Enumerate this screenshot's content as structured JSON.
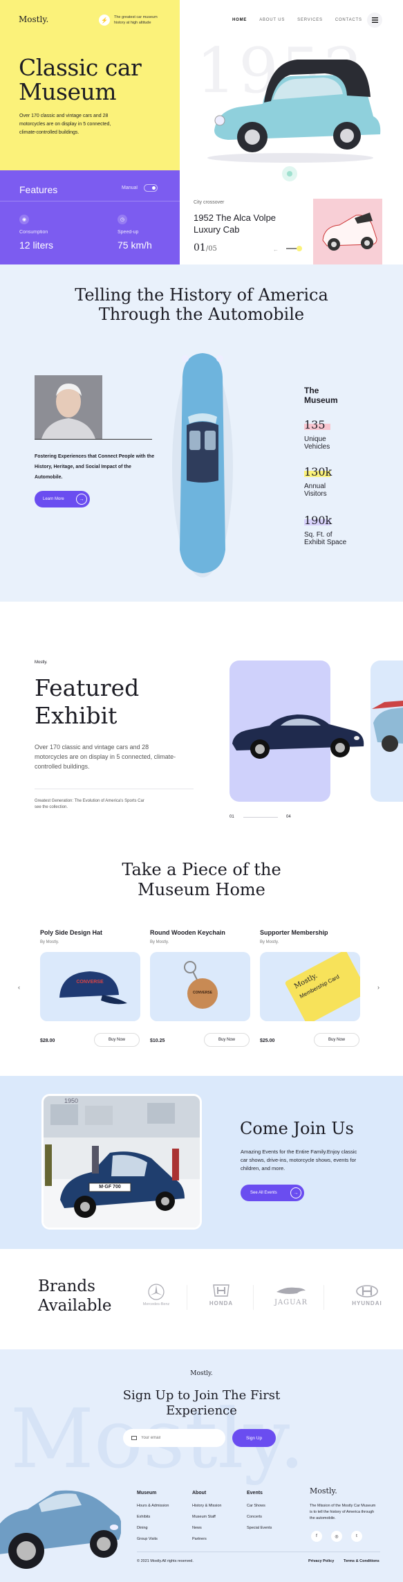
{
  "brand": {
    "logo": "Mostly.",
    "tagline": "The greatest car museum history at high altitude"
  },
  "nav": {
    "items": [
      "HOME",
      "ABOUT US",
      "SERVICES",
      "CONTACTS"
    ],
    "active": "HOME",
    "menu_icon": "hamburger-icon"
  },
  "hero": {
    "title_line1": "Classic car",
    "title_line2": "Museum",
    "description": "Over 170 classic and vintage cars and 28 motorcycles are on display in 5 connected, climate-controlled buildings.",
    "bg_year": "1952",
    "features_label": "Features",
    "manual_label": "Manual",
    "consumption_label": "Consumption",
    "consumption_value": "12 liters",
    "speed_label": "Speed-up",
    "speed_value": "75 km/h",
    "car_category": "City crossover",
    "car_name_line1": "1952 The Alca Volpe",
    "car_name_line2": "Luxury Cab",
    "slide_current": "01",
    "slide_total": "/05",
    "colors": {
      "yellow": "#fbf27a",
      "purple": "#7c5cf0",
      "pink": "#f8cfd6"
    }
  },
  "history": {
    "title_line1": "Telling the History of America",
    "title_line2": "Through the Automobile",
    "description": "Fostering Experiences that Connect People with the History, Heritage, and Social Impact of the Automobile.",
    "cta": "Learn More",
    "museum_label_line1": "The",
    "museum_label_line2": "Museum",
    "stats": [
      {
        "value": "135",
        "label_line1": "Unique",
        "label_line2": "Vehicles",
        "color": "#f8c6d0"
      },
      {
        "value": "130k",
        "label_line1": "Annual",
        "label_line2": "Visitors",
        "color": "#fbf27a"
      },
      {
        "value": "190k",
        "label_line1": "Sq. Ft. of",
        "label_line2": "Exhibit Space",
        "color": "#d8d2fb"
      }
    ]
  },
  "exhibit": {
    "brand": "Mostly.",
    "title_line1": "Featured",
    "title_line2": "Exhibit",
    "description": "Over 170 classic and vintage cars and 28 motorcycles are on display in 5 connected, climate-controlled buildings.",
    "note": "Greatest Generation: The Evolution of America's Sports Car see the collection.",
    "slide_start": "01",
    "slide_end": "04"
  },
  "shop": {
    "title_line1": "Take a Piece of the",
    "title_line2": "Museum Home",
    "products": [
      {
        "name": "Poly Side Design Hat",
        "by": "By Mostly.",
        "price": "$28.00",
        "cta": "Buy Now"
      },
      {
        "name": "Round Wooden Keychain",
        "by": "By Mostly.",
        "price": "$10.25",
        "cta": "Buy Now"
      },
      {
        "name": "Supporter Membership",
        "by": "By Mostly.",
        "price": "$25.00",
        "cta": "Buy Now"
      }
    ],
    "hat_print": "CONVERSE",
    "keychain_print": "CONVERSE",
    "ticket_print_line1": "Mostly.",
    "ticket_print_line2": "Membership Card"
  },
  "join": {
    "title": "Come Join Us",
    "description": "Amazing Events for the Entire Family.Enjoy classic car shows, drive-ins, motorcycle shows, events for children, and more.",
    "cta": "See All Events",
    "plate": "M·GF 700",
    "banner_year": "1950"
  },
  "brands": {
    "title_line1": "Brands",
    "title_line2": "Available",
    "logos": [
      {
        "name": "Mercedes-Benz",
        "icon": "mercedes-icon"
      },
      {
        "name": "HONDA",
        "icon": "honda-icon"
      },
      {
        "name": "JAGUAR",
        "icon": "jaguar-icon"
      },
      {
        "name": "HYUNDAI",
        "icon": "hyundai-icon"
      }
    ]
  },
  "signup": {
    "brand": "Mostly.",
    "title_line1": "Sign Up to Join The First",
    "title_line2": "Experience",
    "email_placeholder": "Your email",
    "cta": "Sign Up",
    "watermark": "Mostly."
  },
  "footer": {
    "columns": [
      {
        "title": "Museum",
        "links": [
          "Hours & Admission",
          "Exhibits",
          "Dining",
          "Group Visits"
        ]
      },
      {
        "title": "About",
        "links": [
          "History & Mission",
          "Museum Staff",
          "News",
          "Partners"
        ]
      },
      {
        "title": "Events",
        "links": [
          "Car Shows",
          "Concerts",
          "Special Events"
        ]
      }
    ],
    "brand": "Mostly.",
    "mission": "The Mission of the Mostly Car Museum is to tell the history of America through the automobile.",
    "social": [
      "f",
      "◎",
      "t"
    ],
    "copyright": "© 2021 Mostly.All rights reserved.",
    "privacy": "Privacy Policy",
    "terms": "Terms & Conditions"
  }
}
